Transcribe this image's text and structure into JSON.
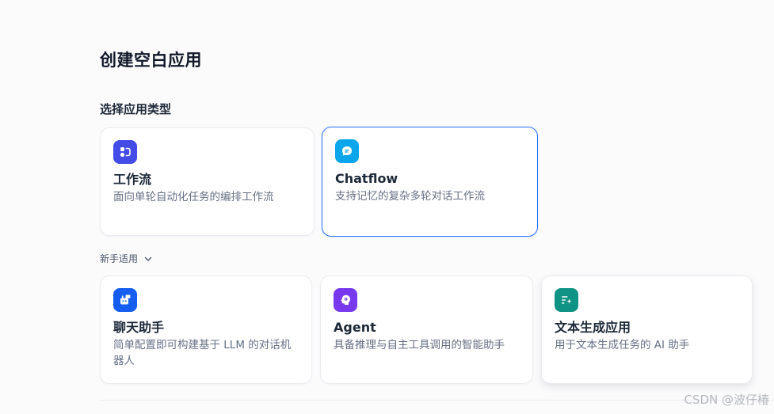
{
  "header": {
    "title": "创建空白应用"
  },
  "section": {
    "label": "选择应用类型"
  },
  "primary_cards": [
    {
      "title": "工作流",
      "description": "面向单轮自动化任务的编排工作流",
      "icon": "workflow-icon",
      "color": "#444ce7"
    },
    {
      "title": "Chatflow",
      "description": "支持记忆的复杂多轮对话工作流",
      "icon": "chatflow-icon",
      "color": "#0ba5ec"
    }
  ],
  "beginner": {
    "label": "新手适用"
  },
  "beginner_cards": [
    {
      "title": "聊天助手",
      "description": "简单配置即可构建基于 LLM 的对话机器人",
      "icon": "chatbot-icon",
      "color": "#155eef"
    },
    {
      "title": "Agent",
      "description": "具备推理与自主工具调用的智能助手",
      "icon": "agent-icon",
      "color": "#7839ee"
    },
    {
      "title": "文本生成应用",
      "description": "用于文本生成任务的 AI 助手",
      "icon": "text-generation-icon",
      "color": "#0e9384"
    }
  ],
  "watermark": "CSDN @波仔椿"
}
